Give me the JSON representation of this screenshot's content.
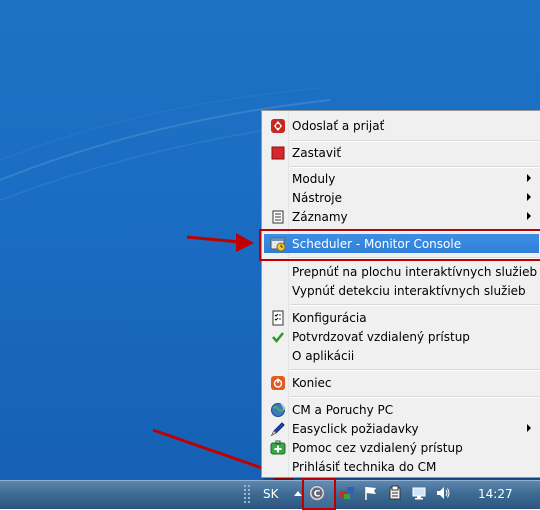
{
  "menu": {
    "items": [
      {
        "label": "Odoslať a prijať",
        "icon": "send-receive-icon",
        "submenu": false
      },
      {
        "label": "Zastaviť",
        "icon": "stop-icon",
        "submenu": false
      },
      {
        "label": "Moduly",
        "icon": "",
        "submenu": true
      },
      {
        "label": "Nástroje",
        "icon": "",
        "submenu": true
      },
      {
        "label": "Záznamy",
        "icon": "records-icon",
        "submenu": true
      },
      {
        "label": "Scheduler - Monitor Console",
        "icon": "scheduler-icon",
        "submenu": false,
        "highlighted": true
      },
      {
        "label": "Prepnúť na plochu interaktívnych služieb",
        "icon": "",
        "submenu": false
      },
      {
        "label": "Vypnúť detekciu interaktívnych služieb",
        "icon": "",
        "submenu": false
      },
      {
        "label": "Konfigurácia",
        "icon": "configuration-icon",
        "submenu": false
      },
      {
        "label": "Potvrdzovať vzdialený prístup",
        "icon": "checkmark-icon",
        "submenu": false
      },
      {
        "label": "O aplikácii",
        "icon": "",
        "submenu": false
      },
      {
        "label": "Koniec",
        "icon": "exit-icon",
        "submenu": false
      },
      {
        "label": "CM a Poruchy PC",
        "icon": "globe-icon",
        "submenu": false
      },
      {
        "label": "Easyclick požiadavky",
        "icon": "pen-icon",
        "submenu": true
      },
      {
        "label": "Pomoc cez vzdialený prístup",
        "icon": "help-kit-icon",
        "submenu": false
      },
      {
        "label": "Prihlásiť technika do CM",
        "icon": "",
        "submenu": false
      }
    ]
  },
  "taskbar": {
    "language": "SK",
    "clock": "14:27"
  },
  "colors": {
    "highlight": "#3184db",
    "annotation": "#c00000"
  }
}
